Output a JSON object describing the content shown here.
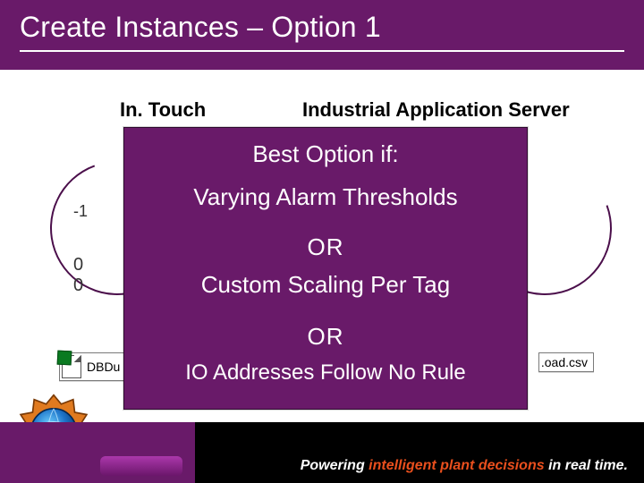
{
  "title": "Create Instances – Option 1",
  "columns": {
    "left_label": "In. Touch",
    "right_label": "Industrial Application Server"
  },
  "decor": {
    "neg1": "-1",
    "side_a": "0",
    "side_b": "0"
  },
  "overlay": {
    "heading": "Best Option if:",
    "line_a": "Varying Alarm Thresholds",
    "or_1": "OR",
    "line_b": "Custom Scaling Per Tag",
    "or_2": "OR",
    "line_c": "IO Addresses Follow No Rule"
  },
  "files": {
    "left_label": "DBDu",
    "right_label": ".oad.csv"
  },
  "banner": {
    "tag_prefix": "Powering ",
    "tag_highlight": "intelligent plant decisions",
    "tag_suffix": " in real time."
  },
  "icons": {
    "globe": "globe-logo",
    "excel": "spreadsheet-icon"
  }
}
